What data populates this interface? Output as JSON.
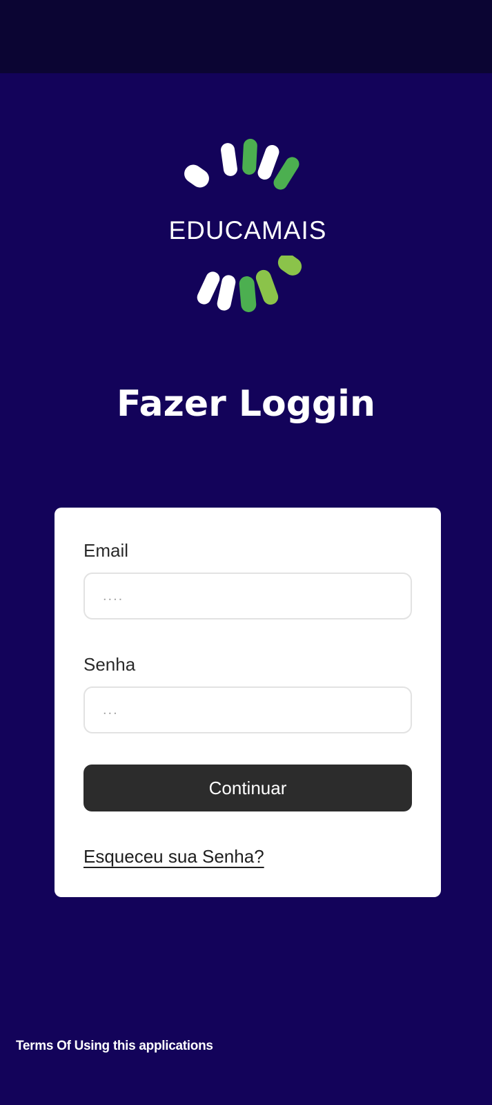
{
  "logo": {
    "text": "EDUCAMAIS",
    "colors": {
      "white": "#ffffff",
      "green": "#4caf50",
      "light_green": "#8bc34a"
    }
  },
  "page": {
    "title": "Fazer Loggin"
  },
  "form": {
    "email": {
      "label": "Email",
      "placeholder": "....",
      "value": ""
    },
    "password": {
      "label": "Senha",
      "placeholder": "...",
      "value": ""
    },
    "continue_label": "Continuar",
    "forgot_label": "Esqueceu sua Senha?"
  },
  "footer": {
    "terms_label": "Terms Of Using this applications"
  },
  "colors": {
    "background": "#13035a",
    "status_bar": "#0b0533",
    "card": "#ffffff",
    "button": "#2c2c2c"
  }
}
